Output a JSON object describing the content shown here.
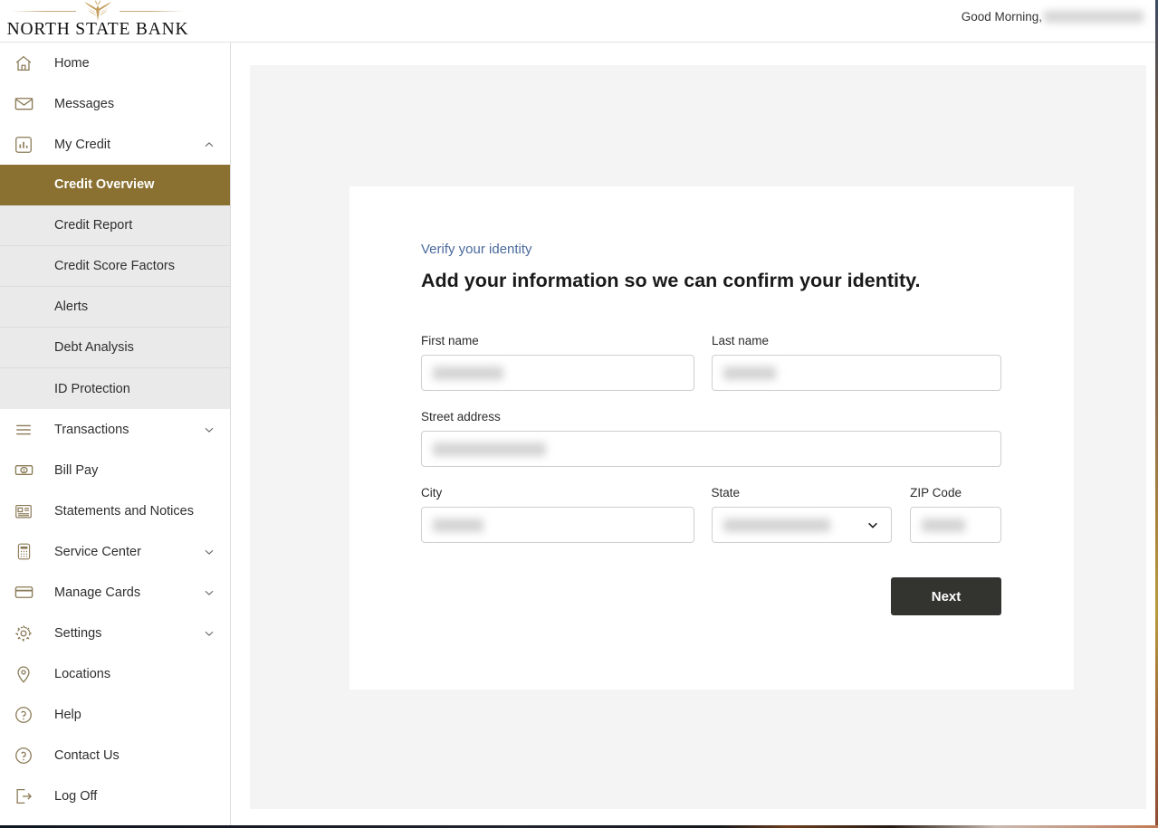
{
  "header": {
    "logo_name": "NORTH STATE BANK",
    "logo_icon": "wheat-sheaf-icon",
    "greeting_prefix": "Good Morning,",
    "greeting_name_redacted": true,
    "greeting_name": ""
  },
  "sidebar": {
    "items": [
      {
        "label": "Home",
        "icon": "home-icon",
        "expandable": false
      },
      {
        "label": "Messages",
        "icon": "envelope-icon",
        "expandable": false
      },
      {
        "label": "My Credit",
        "icon": "bar-chart-icon",
        "expandable": true,
        "expanded": true,
        "chevron": "chevron-up-icon"
      },
      {
        "label": "Transactions",
        "icon": "list-lines-icon",
        "expandable": true,
        "expanded": false,
        "chevron": "chevron-down-icon"
      },
      {
        "label": "Bill Pay",
        "icon": "dollar-bill-icon",
        "expandable": false
      },
      {
        "label": "Statements and Notices",
        "icon": "newspaper-icon",
        "expandable": false
      },
      {
        "label": "Service Center",
        "icon": "calculator-icon",
        "expandable": true,
        "expanded": false,
        "chevron": "chevron-down-icon"
      },
      {
        "label": "Manage Cards",
        "icon": "credit-card-icon",
        "expandable": true,
        "expanded": false,
        "chevron": "chevron-down-icon"
      },
      {
        "label": "Settings",
        "icon": "gear-icon",
        "expandable": true,
        "expanded": false,
        "chevron": "chevron-down-icon"
      },
      {
        "label": "Locations",
        "icon": "map-pin-icon",
        "expandable": false
      },
      {
        "label": "Help",
        "icon": "question-circle-icon",
        "expandable": false
      },
      {
        "label": "Contact Us",
        "icon": "question-circle-icon",
        "expandable": false
      },
      {
        "label": "Log Off",
        "icon": "logout-icon",
        "expandable": false
      }
    ],
    "my_credit_submenu": [
      {
        "label": "Credit Overview",
        "active": true
      },
      {
        "label": "Credit Report",
        "active": false
      },
      {
        "label": "Credit Score Factors",
        "active": false
      },
      {
        "label": "Alerts",
        "active": false
      },
      {
        "label": "Debt Analysis",
        "active": false
      },
      {
        "label": "ID Protection",
        "active": false
      }
    ]
  },
  "main": {
    "eyebrow": "Verify your identity",
    "headline": "Add your information so we can confirm your identity.",
    "fields": {
      "first_name": {
        "label": "First name",
        "value": "",
        "redacted": true,
        "redacted_width": 78
      },
      "last_name": {
        "label": "Last name",
        "value": "",
        "redacted": true,
        "redacted_width": 58
      },
      "street_address": {
        "label": "Street address",
        "value": "",
        "redacted": true,
        "redacted_width": 125
      },
      "city": {
        "label": "City",
        "value": "",
        "redacted": true,
        "redacted_width": 56
      },
      "state": {
        "label": "State",
        "value": "",
        "redacted": true,
        "redacted_width": 118,
        "type": "select",
        "chevron": "chevron-down-icon"
      },
      "zip_code": {
        "label": "ZIP Code",
        "value": "",
        "redacted": true,
        "redacted_width": 48
      }
    },
    "next_label": "Next"
  },
  "colors": {
    "brand_gold": "#8a7132",
    "icon_gold": "#8a7a56",
    "eyebrow_blue": "#4a6a9b",
    "button_dark": "#333330",
    "panel_gray": "#f4f4f4",
    "submenu_gray": "#eaeaea"
  }
}
